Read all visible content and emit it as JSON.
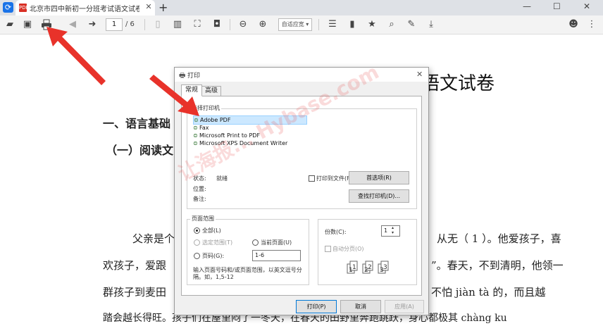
{
  "browser": {
    "tab_title": "北京市四中新初一分班考试语文试卷真题",
    "tab_close": "✕",
    "new_tab": "+",
    "window_min": "—",
    "window_max": "☐",
    "window_close": "✕"
  },
  "toolbar": {
    "page_current": "1",
    "page_total": "/ 6",
    "zoom": "自适应宽 ▾"
  },
  "document": {
    "title": "语文试卷",
    "section1": "一、语言基础",
    "section2": "（一）阅读文",
    "line1_left": "父亲是个",
    "line1_right": "从无（ 1 ）。他爱孩子，喜",
    "line2_left": "欢孩子，爱跟",
    "line2_right": "”。春天，不到清明，他领一",
    "line3_left": "群孩子到麦田",
    "line3_right": "不怕 jiàn tà 的，而且越",
    "line4": "踏会越长得旺。孩子们在屋里闷了一冬天，在春天的田野里奔跑跳跃，身心都极其 chàng ku",
    "watermark": "让海报... Hybase.com"
  },
  "dialog": {
    "title": "打印",
    "close": "✕",
    "tab_general": "常规",
    "tab_advanced": "高级",
    "select_printer_label": "选择打印机",
    "printers": [
      "Adobe PDF",
      "Fax",
      "Microsoft Print to PDF",
      "Microsoft XPS Document Writer"
    ],
    "status_label": "状态:",
    "status_value": "就绪",
    "location_label": "位置:",
    "comment_label": "备注:",
    "print_to_file": "打印到文件(F)",
    "preferences_button": "首选项(R)",
    "find_printer_button": "查找打印机(D)...",
    "page_range_label": "页面范围",
    "range_all": "全部(L)",
    "range_selection": "选定范围(T)",
    "range_current": "当前页面(U)",
    "range_pages": "页码(G):",
    "pages_value": "1-6",
    "range_hint": "输入页面号码和/或页面范围，以英文逗号分隔。如，1,5-12",
    "copies_label": "份数(C):",
    "copies_value": "1",
    "collate_label": "自动分页(O)",
    "print_button": "打印(P)",
    "cancel_button": "取消",
    "apply_button": "应用(A)"
  },
  "colors": {
    "annotation_arrow": "#e8322a",
    "selected_printer_bg": "#cce8ff",
    "primary_button_border": "#0078d7"
  }
}
